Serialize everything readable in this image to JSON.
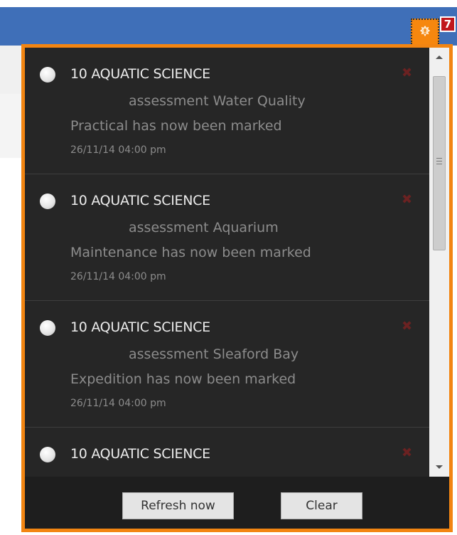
{
  "header": {
    "notification_count": "7"
  },
  "notifications": [
    {
      "title": "10 AQUATIC SCIENCE",
      "line1": "assessment Water Quality",
      "line2": "Practical has now been marked",
      "date": "26/11/14 04:00 pm"
    },
    {
      "title": "10 AQUATIC SCIENCE",
      "line1": "assessment Aquarium",
      "line2": "Maintenance has now been marked",
      "date": "26/11/14 04:00 pm"
    },
    {
      "title": "10 AQUATIC SCIENCE",
      "line1": "assessment Sleaford Bay",
      "line2": "Expedition has now been marked",
      "date": "26/11/14 04:00 pm"
    },
    {
      "title": "10 AQUATIC SCIENCE",
      "line1": "",
      "line2": "",
      "date": ""
    }
  ],
  "close_glyph": "✖",
  "footer": {
    "refresh_label": "Refresh now",
    "clear_label": "Clear"
  },
  "colors": {
    "accent": "#f28512",
    "header": "#3f6fb8",
    "panel_bg": "#262626",
    "badge": "#c0161c"
  },
  "icons": {
    "notification": "bell-icon",
    "status": "status-dot-icon",
    "dismiss": "close-icon"
  }
}
